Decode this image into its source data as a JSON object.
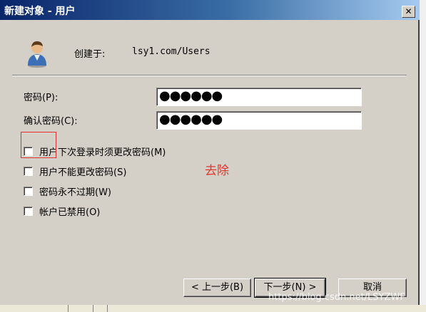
{
  "window": {
    "title": "新建对象 - 用户",
    "close_label": "✕"
  },
  "header": {
    "created_in_label": "创建于:",
    "created_in_value": "lsy1.com/Users"
  },
  "fields": {
    "password_label": "密码(P):",
    "password_value": "●●●●●●",
    "confirm_label": "确认密码(C):",
    "confirm_value": "●●●●●●"
  },
  "options": [
    {
      "label": "用户下次登录时须更改密码(M)",
      "checked": false
    },
    {
      "label": "用户不能更改密码(S)",
      "checked": false
    },
    {
      "label": "密码永不过期(W)",
      "checked": false
    },
    {
      "label": "帐户已禁用(O)",
      "checked": false
    }
  ],
  "annotation": {
    "text": "去除",
    "color": "#e8342a"
  },
  "buttons": {
    "back": "< 上一步(B)",
    "next": "下一步(N) >",
    "cancel": "取消"
  },
  "watermark": "https://blog.csdn.net/LSYZWF",
  "colors": {
    "title_bar_start": "#0a246a",
    "title_bar_end": "#a6caf0",
    "dialog_bg": "#d4d0c8"
  }
}
